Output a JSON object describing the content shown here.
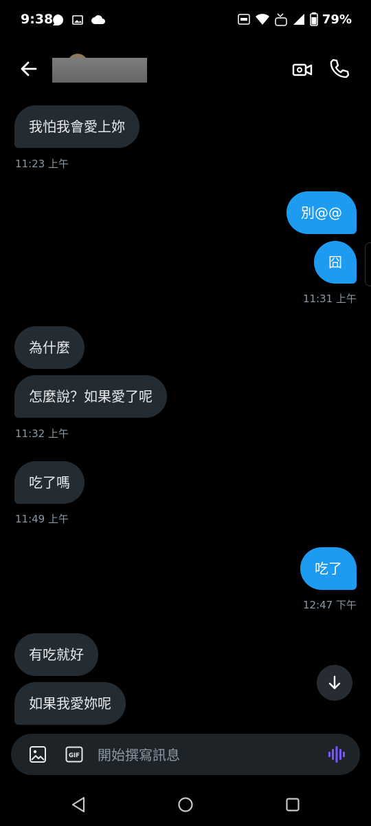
{
  "status_bar": {
    "time": "9:38",
    "battery_percent": "79%",
    "icons": [
      "chat-bubble-icon",
      "image-icon",
      "cloud-icon",
      "auto-icon",
      "wifi-icon",
      "volte-icon",
      "signal-icon",
      "battery-icon"
    ]
  },
  "header": {
    "contact_name": "",
    "icons": [
      "back-arrow-icon",
      "video-camera-icon",
      "phone-icon"
    ]
  },
  "messages": [
    {
      "id": "m1",
      "direction": "incoming",
      "text": "我怕我會愛上妳"
    },
    {
      "id": "t1",
      "stamp": "11:23 上午"
    },
    {
      "id": "m2",
      "direction": "outgoing",
      "text": "別@@"
    },
    {
      "id": "m3",
      "direction": "outgoing",
      "text": "囧"
    },
    {
      "id": "t2",
      "stamp": "11:31 上午"
    },
    {
      "id": "m4",
      "direction": "incoming",
      "text": "為什麼"
    },
    {
      "id": "m5",
      "direction": "incoming",
      "text": "怎麼說？如果愛了呢"
    },
    {
      "id": "t3",
      "stamp": "11:32 上午"
    },
    {
      "id": "m6",
      "direction": "incoming",
      "text": "吃了嗎"
    },
    {
      "id": "t4",
      "stamp": "11:49 上午"
    },
    {
      "id": "m7",
      "direction": "outgoing",
      "text": "吃了"
    },
    {
      "id": "t5",
      "stamp": "12:47 下午"
    },
    {
      "id": "m8",
      "direction": "incoming",
      "text": "有吃就好"
    },
    {
      "id": "m9",
      "direction": "incoming",
      "text": "如果我愛妳呢"
    }
  ],
  "composer": {
    "placeholder": "開始撰寫訊息",
    "gif_label": "GIF"
  },
  "colors": {
    "background": "#000000",
    "incoming_bubble": "#242c33",
    "outgoing_bubble": "#1d9bf0",
    "timestamp": "#8b98a5",
    "voice_accent": "#7856ff"
  }
}
